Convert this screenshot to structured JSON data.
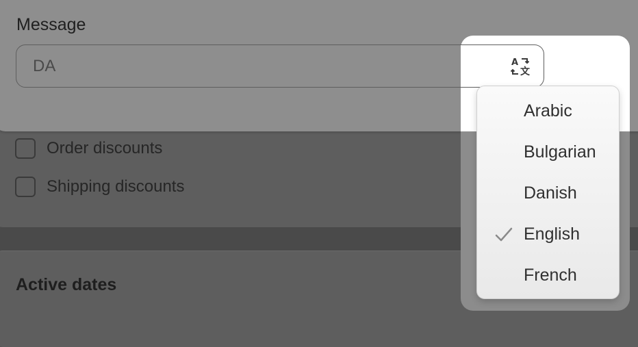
{
  "message": {
    "label": "Message",
    "value": "DA"
  },
  "options": {
    "items": [
      {
        "label": "Order discounts",
        "checked": false
      },
      {
        "label": "Shipping discounts",
        "checked": false
      }
    ]
  },
  "active_dates": {
    "title": "Active dates"
  },
  "translate": {
    "icon": "translate-icon"
  },
  "language_menu": {
    "selected": "English",
    "items": [
      "Arabic",
      "Bulgarian",
      "Danish",
      "English",
      "French"
    ]
  }
}
